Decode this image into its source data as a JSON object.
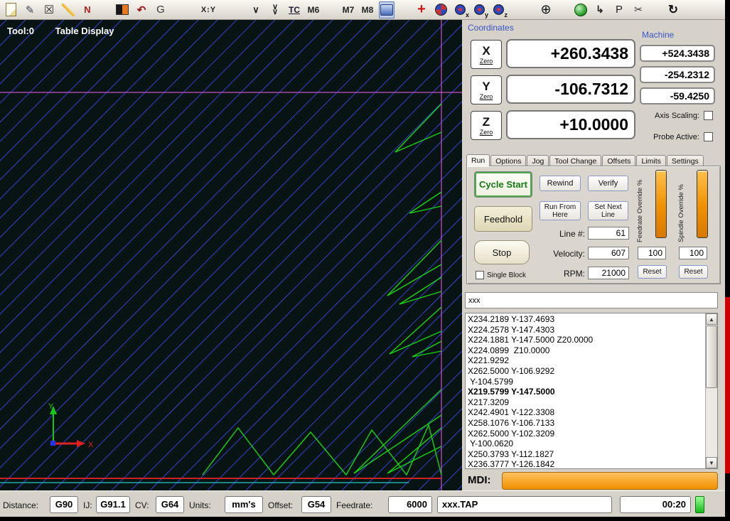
{
  "canvas": {
    "tool_label": "Tool:0",
    "display_label": "Table Display",
    "axis_labels": {
      "x": "X",
      "y": "Y"
    },
    "colors": {
      "background": "#081414",
      "hatch": "#3240c8",
      "path": "#12d412",
      "boundary": "#c850c8",
      "red_line": "#cc2222",
      "cyan_line": "#22c8c8",
      "axis_x": "#e02020",
      "axis_y": "#18c818",
      "origin": "#2233ee"
    }
  },
  "toolbar": {
    "icons": [
      {
        "name": "new-file-icon",
        "shape": "page"
      },
      {
        "name": "edit-file-icon",
        "glyph": "✎",
        "color": "#445",
        "size": 15
      },
      {
        "name": "close-file-icon",
        "glyph": "☒",
        "color": "#333",
        "size": 16
      },
      {
        "name": "wizard-icon",
        "shape": "wand"
      },
      {
        "name": "edit-nc-icon",
        "glyph": "N",
        "color": "#b02020",
        "bold": true,
        "size": 13
      },
      {
        "sep": "small"
      },
      {
        "name": "palette-icon",
        "shape": "palette"
      },
      {
        "name": "undo-icon",
        "glyph": "↶",
        "color": "#9a1818",
        "bold": true,
        "size": 15
      },
      {
        "name": "gcode-icon",
        "glyph": "G",
        "color": "#3a3a3a",
        "size": 15
      },
      {
        "sep": "big"
      },
      {
        "name": "xy-plane-icon",
        "glyph": "X↕Y",
        "color": "#222",
        "size": 11,
        "bold": true
      },
      {
        "sep": "big"
      },
      {
        "name": "chevron-down-icon",
        "glyph": "∨",
        "color": "#222",
        "size": 13,
        "bold": true
      },
      {
        "name": "double-chevron-down-icon",
        "glyph": "∨",
        "stacked": true,
        "color": "#222"
      },
      {
        "name": "tool-change-icon",
        "glyph": "TC",
        "color": "#1a1a2e",
        "size": 12,
        "bold": true,
        "underline": true
      },
      {
        "name": "m6-icon",
        "glyph": "M6",
        "color": "#222",
        "size": 12,
        "bold": true
      },
      {
        "sep": "small"
      },
      {
        "name": "m7-icon",
        "glyph": "M7",
        "color": "#222",
        "size": 12,
        "bold": true
      },
      {
        "name": "m8-icon",
        "glyph": "M8",
        "color": "#222",
        "size": 12,
        "bold": true
      },
      {
        "name": "spindle-icon",
        "shape": "machine",
        "pressed": true
      },
      {
        "sep": "small"
      },
      {
        "name": "goto-zero-icon",
        "glyph": "+",
        "color": "#cc1818",
        "size": 20,
        "bold": true
      },
      {
        "name": "ref-all-icon",
        "shape": "circle-rb"
      },
      {
        "name": "ref-x-icon",
        "shape": "circle-axis",
        "sub": "x"
      },
      {
        "name": "ref-y-icon",
        "shape": "circle-axis",
        "sub": "y"
      },
      {
        "name": "ref-z-icon",
        "shape": "circle-axis",
        "sub": "z"
      },
      {
        "sep": "big"
      },
      {
        "name": "crosshair-icon",
        "glyph": "⊕",
        "color": "#111",
        "size": 18
      },
      {
        "sep": "small"
      },
      {
        "name": "globe-icon",
        "shape": "globe"
      },
      {
        "name": "return-arrow-icon",
        "glyph": "↳",
        "color": "#222",
        "size": 14,
        "bold": true
      },
      {
        "name": "park-icon",
        "glyph": "P",
        "color": "#222",
        "size": 15
      },
      {
        "name": "scissors-icon",
        "glyph": "✂",
        "color": "#333",
        "size": 14
      },
      {
        "sep": "small"
      },
      {
        "name": "regen-icon",
        "glyph": "↻",
        "color": "#111",
        "size": 17,
        "bold": true
      }
    ]
  },
  "coordinates": {
    "section_label": "Coordinates",
    "machine_label": "Machine",
    "zero_label": "Zero",
    "axes": [
      {
        "axis": "X",
        "value": "+260.3438",
        "machine": "+524.3438"
      },
      {
        "axis": "Y",
        "value": "-106.7312",
        "machine": "-254.2312"
      },
      {
        "axis": "Z",
        "value": "+10.0000",
        "machine": "-59.4250"
      }
    ],
    "axis_scaling_label": "Axis Scaling:",
    "probe_active_label": "Probe Active:"
  },
  "tabs": {
    "labels": [
      "Run",
      "Options",
      "Jog",
      "Tool Change",
      "Offsets",
      "Limits",
      "Settings"
    ],
    "active_index": 0
  },
  "run_tab": {
    "cycle_start_label": "Cycle Start",
    "rewind_label": "Rewind",
    "verify_label": "Verify",
    "feedhold_label": "Feedhold",
    "run_from_here_label": "Run From Here",
    "set_next_line_label": "Set Next Line",
    "line_label": "Line #:",
    "line_value": "61",
    "velocity_label": "Velocity:",
    "velocity_value": "607",
    "rpm_label": "RPM:",
    "rpm_value": "21000",
    "stop_label": "Stop",
    "single_block_label": "Single Block",
    "feedrate_override_label": "Feedrate Override %",
    "spindle_override_label": "Spindle Override %",
    "feedrate_override_value": "100",
    "spindle_override_value": "100",
    "reset_label": "Reset"
  },
  "gcode": {
    "filter_value": "xxx",
    "highlight_index": 7,
    "lines": [
      "X234.2189 Y-137.4693",
      "X224.2578 Y-147.4303",
      "X224.1881 Y-147.5000 Z20.0000",
      "X224.0899  Z10.0000",
      "X221.9292",
      "X262.5000 Y-106.9292",
      " Y-104.5799",
      "X219.5799 Y-147.5000",
      "X217.3209",
      "X242.4901 Y-122.3308",
      "X258.1076 Y-106.7133",
      "X262.5000 Y-102.3209",
      " Y-100.0620",
      "X250.3793 Y-112.1827",
      "X236.3777 Y-126.1842"
    ]
  },
  "icons": {
    "scroll_up": "▲",
    "scroll_down": "▼"
  },
  "mdi": {
    "label": "MDI:",
    "value": ""
  },
  "status_bar": {
    "distance_label": "Distance:",
    "distance_value": "G90",
    "ij_label": "IJ:",
    "ij_value": "G91.1",
    "cv_label": "CV:",
    "cv_value": "G64",
    "units_label": "Units:",
    "units_value": "mm's",
    "offset_label": "Offset:",
    "offset_value": "G54",
    "feedrate_label": "Feedrate:",
    "feedrate_value": "6000",
    "file_name": "xxx.TAP",
    "timer_value": "00:20"
  }
}
